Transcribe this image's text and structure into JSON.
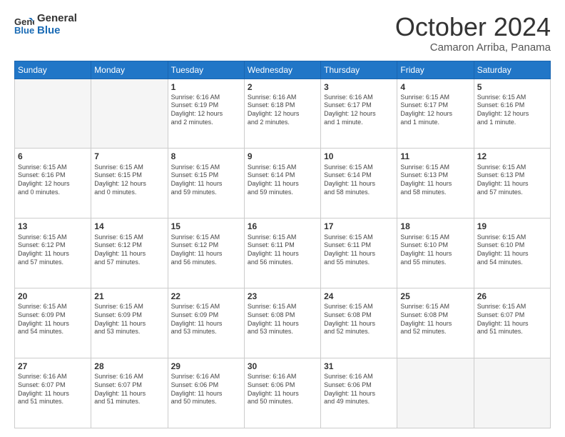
{
  "header": {
    "logo_line1": "General",
    "logo_line2": "Blue",
    "month": "October 2024",
    "location": "Camaron Arriba, Panama"
  },
  "days_of_week": [
    "Sunday",
    "Monday",
    "Tuesday",
    "Wednesday",
    "Thursday",
    "Friday",
    "Saturday"
  ],
  "weeks": [
    [
      {
        "day": "",
        "info": ""
      },
      {
        "day": "",
        "info": ""
      },
      {
        "day": "1",
        "info": "Sunrise: 6:16 AM\nSunset: 6:19 PM\nDaylight: 12 hours\nand 2 minutes."
      },
      {
        "day": "2",
        "info": "Sunrise: 6:16 AM\nSunset: 6:18 PM\nDaylight: 12 hours\nand 2 minutes."
      },
      {
        "day": "3",
        "info": "Sunrise: 6:16 AM\nSunset: 6:17 PM\nDaylight: 12 hours\nand 1 minute."
      },
      {
        "day": "4",
        "info": "Sunrise: 6:15 AM\nSunset: 6:17 PM\nDaylight: 12 hours\nand 1 minute."
      },
      {
        "day": "5",
        "info": "Sunrise: 6:15 AM\nSunset: 6:16 PM\nDaylight: 12 hours\nand 1 minute."
      }
    ],
    [
      {
        "day": "6",
        "info": "Sunrise: 6:15 AM\nSunset: 6:16 PM\nDaylight: 12 hours\nand 0 minutes."
      },
      {
        "day": "7",
        "info": "Sunrise: 6:15 AM\nSunset: 6:15 PM\nDaylight: 12 hours\nand 0 minutes."
      },
      {
        "day": "8",
        "info": "Sunrise: 6:15 AM\nSunset: 6:15 PM\nDaylight: 11 hours\nand 59 minutes."
      },
      {
        "day": "9",
        "info": "Sunrise: 6:15 AM\nSunset: 6:14 PM\nDaylight: 11 hours\nand 59 minutes."
      },
      {
        "day": "10",
        "info": "Sunrise: 6:15 AM\nSunset: 6:14 PM\nDaylight: 11 hours\nand 58 minutes."
      },
      {
        "day": "11",
        "info": "Sunrise: 6:15 AM\nSunset: 6:13 PM\nDaylight: 11 hours\nand 58 minutes."
      },
      {
        "day": "12",
        "info": "Sunrise: 6:15 AM\nSunset: 6:13 PM\nDaylight: 11 hours\nand 57 minutes."
      }
    ],
    [
      {
        "day": "13",
        "info": "Sunrise: 6:15 AM\nSunset: 6:12 PM\nDaylight: 11 hours\nand 57 minutes."
      },
      {
        "day": "14",
        "info": "Sunrise: 6:15 AM\nSunset: 6:12 PM\nDaylight: 11 hours\nand 57 minutes."
      },
      {
        "day": "15",
        "info": "Sunrise: 6:15 AM\nSunset: 6:12 PM\nDaylight: 11 hours\nand 56 minutes."
      },
      {
        "day": "16",
        "info": "Sunrise: 6:15 AM\nSunset: 6:11 PM\nDaylight: 11 hours\nand 56 minutes."
      },
      {
        "day": "17",
        "info": "Sunrise: 6:15 AM\nSunset: 6:11 PM\nDaylight: 11 hours\nand 55 minutes."
      },
      {
        "day": "18",
        "info": "Sunrise: 6:15 AM\nSunset: 6:10 PM\nDaylight: 11 hours\nand 55 minutes."
      },
      {
        "day": "19",
        "info": "Sunrise: 6:15 AM\nSunset: 6:10 PM\nDaylight: 11 hours\nand 54 minutes."
      }
    ],
    [
      {
        "day": "20",
        "info": "Sunrise: 6:15 AM\nSunset: 6:09 PM\nDaylight: 11 hours\nand 54 minutes."
      },
      {
        "day": "21",
        "info": "Sunrise: 6:15 AM\nSunset: 6:09 PM\nDaylight: 11 hours\nand 53 minutes."
      },
      {
        "day": "22",
        "info": "Sunrise: 6:15 AM\nSunset: 6:09 PM\nDaylight: 11 hours\nand 53 minutes."
      },
      {
        "day": "23",
        "info": "Sunrise: 6:15 AM\nSunset: 6:08 PM\nDaylight: 11 hours\nand 53 minutes."
      },
      {
        "day": "24",
        "info": "Sunrise: 6:15 AM\nSunset: 6:08 PM\nDaylight: 11 hours\nand 52 minutes."
      },
      {
        "day": "25",
        "info": "Sunrise: 6:15 AM\nSunset: 6:08 PM\nDaylight: 11 hours\nand 52 minutes."
      },
      {
        "day": "26",
        "info": "Sunrise: 6:15 AM\nSunset: 6:07 PM\nDaylight: 11 hours\nand 51 minutes."
      }
    ],
    [
      {
        "day": "27",
        "info": "Sunrise: 6:16 AM\nSunset: 6:07 PM\nDaylight: 11 hours\nand 51 minutes."
      },
      {
        "day": "28",
        "info": "Sunrise: 6:16 AM\nSunset: 6:07 PM\nDaylight: 11 hours\nand 51 minutes."
      },
      {
        "day": "29",
        "info": "Sunrise: 6:16 AM\nSunset: 6:06 PM\nDaylight: 11 hours\nand 50 minutes."
      },
      {
        "day": "30",
        "info": "Sunrise: 6:16 AM\nSunset: 6:06 PM\nDaylight: 11 hours\nand 50 minutes."
      },
      {
        "day": "31",
        "info": "Sunrise: 6:16 AM\nSunset: 6:06 PM\nDaylight: 11 hours\nand 49 minutes."
      },
      {
        "day": "",
        "info": ""
      },
      {
        "day": "",
        "info": ""
      }
    ]
  ]
}
